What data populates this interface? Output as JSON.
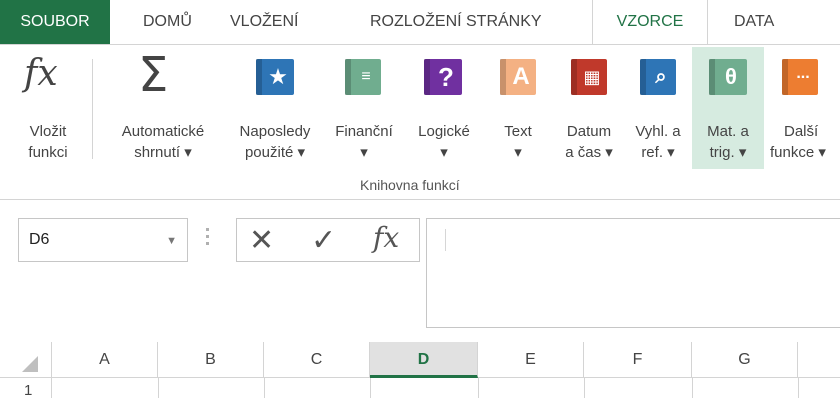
{
  "tabs": [
    {
      "label": "SOUBOR"
    },
    {
      "label": "DOMŮ"
    },
    {
      "label": "VLOŽENÍ"
    },
    {
      "label": "ROZLOŽENÍ STRÁNKY"
    },
    {
      "label": "VZORCE",
      "active": true
    },
    {
      "label": "DATA"
    }
  ],
  "ribbon": {
    "insert_function": {
      "line1": "Vložit",
      "line2": "funkci",
      "glyph": "fx"
    },
    "autosum": {
      "line1": "Automatické",
      "line2": "shrnutí ▾",
      "glyph": "Σ"
    },
    "recently_used": {
      "line1": "Naposledy",
      "line2": "použité ▾",
      "glyph": "★"
    },
    "financial": {
      "line1": "Finanční",
      "line2": "▾"
    },
    "logical": {
      "line1": "Logické",
      "line2": "▾",
      "glyph": "?"
    },
    "text": {
      "line1": "Text",
      "line2": "▾",
      "glyph": "A"
    },
    "date_time": {
      "line1": "Datum",
      "line2": "a čas ▾"
    },
    "lookup": {
      "line1": "Vyhl. a",
      "line2": "ref. ▾"
    },
    "math_trig": {
      "line1": "Mat. a",
      "line2": "trig. ▾",
      "glyph": "θ"
    },
    "more": {
      "line1": "Další",
      "line2": "funkce ▾",
      "glyph": "..."
    },
    "group_label": "Knihovna funkcí"
  },
  "formula_bar": {
    "name_box": "D6",
    "cancel_glyph": "✕",
    "enter_glyph": "✓",
    "fx_glyph": "fx",
    "value": ""
  },
  "grid": {
    "columns": [
      "A",
      "B",
      "C",
      "D",
      "E",
      "F",
      "G"
    ],
    "active_column": "D",
    "rows": [
      "1"
    ]
  },
  "colors": {
    "accent": "#217346",
    "highlight": "#d6ebe0",
    "book_blue": "#2e75b6",
    "book_green": "#70ad8f",
    "book_purple": "#7030a0",
    "book_orange": "#f4b183",
    "book_red": "#c0392b",
    "book_teal": "#5b9bd5",
    "book_dark_orange": "#ed7d31"
  }
}
